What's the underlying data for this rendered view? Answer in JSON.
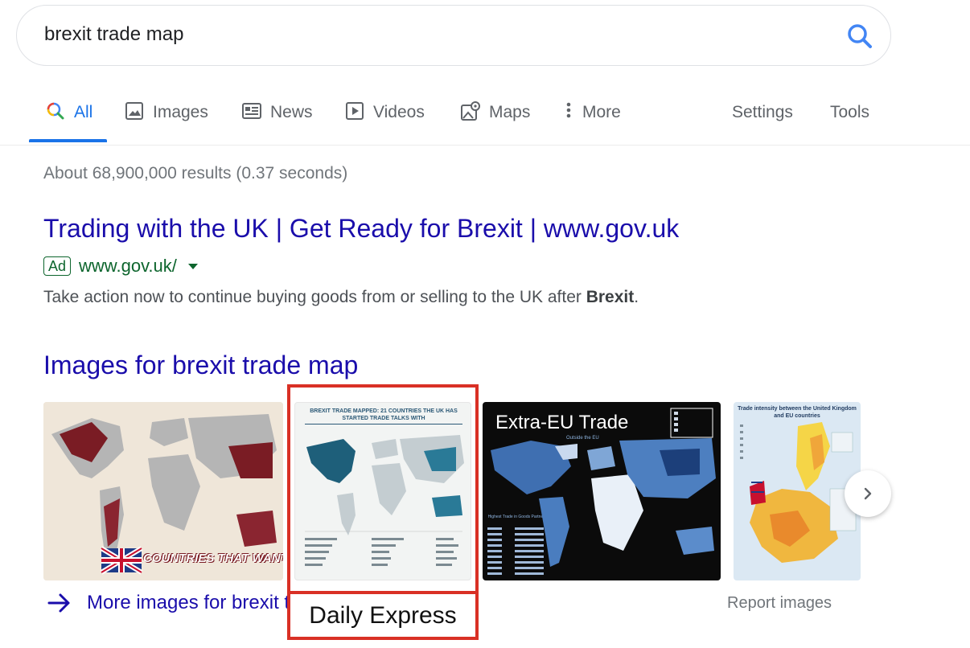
{
  "search": {
    "query": "brexit trade map"
  },
  "tabs": [
    {
      "label": "All",
      "icon": "search-icon"
    },
    {
      "label": "Images",
      "icon": "image-icon"
    },
    {
      "label": "News",
      "icon": "news-icon"
    },
    {
      "label": "Videos",
      "icon": "video-icon"
    },
    {
      "label": "Maps",
      "icon": "map-icon"
    },
    {
      "label": "More",
      "icon": "more-vert-icon"
    }
  ],
  "tools": {
    "settings": "Settings",
    "tools": "Tools"
  },
  "result_stats": "About 68,900,000 results (0.37 seconds)",
  "ad": {
    "title": "Trading with the UK | Get Ready for Brexit | www.gov.uk",
    "badge": "Ad",
    "url": "www.gov.uk/",
    "description_prefix": "Take action now to continue buying goods from or selling to the UK after ",
    "description_bold": "Brexit",
    "description_suffix": "."
  },
  "images_section": {
    "heading": "Images for brexit trade map",
    "thumbnails": [
      {
        "caption": "COUNTRIES THAT WANT A DEA"
      },
      {
        "title": "BREXIT TRADE MAPPED: 21 COUNTRIES THE UK HAS STARTED TRADE TALKS WITH"
      },
      {
        "title": "Extra-EU Trade",
        "subtitle": "Outside the EU",
        "table_heading": "Highest Trade in Goods Partners"
      },
      {
        "title": "Trade intensity between the United Kingdom and EU countries"
      }
    ],
    "more_link": "More images for brexit trade map",
    "report": "Report images"
  },
  "annotation": {
    "label": "Daily Express"
  },
  "colors": {
    "link": "#1a0dab",
    "accent": "#1a73e8",
    "url_green": "#0d652d",
    "highlight": "#d93025"
  }
}
